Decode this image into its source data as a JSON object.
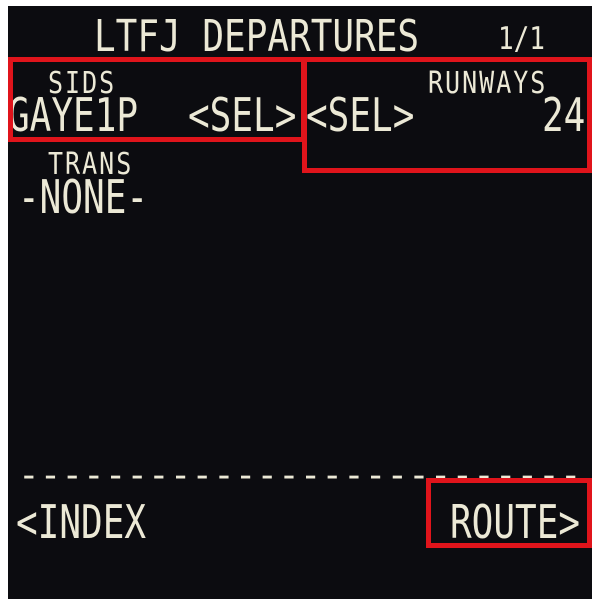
{
  "header": {
    "title": "LTFJ DEPARTURES",
    "page": "1/1"
  },
  "sids": {
    "label": "SIDS",
    "value": "GAYE1P",
    "sel": "<SEL>"
  },
  "runways": {
    "label": "RUNWAYS",
    "sel": "<SEL>",
    "value": "24"
  },
  "trans": {
    "label": "TRANS",
    "value": "-NONE-"
  },
  "separator": "--------------------------",
  "footer": {
    "left": "<INDEX",
    "right": "ROUTE>"
  },
  "colors": {
    "text": "#ece9d6",
    "background": "#0c0c10",
    "highlight": "#e0141b"
  }
}
